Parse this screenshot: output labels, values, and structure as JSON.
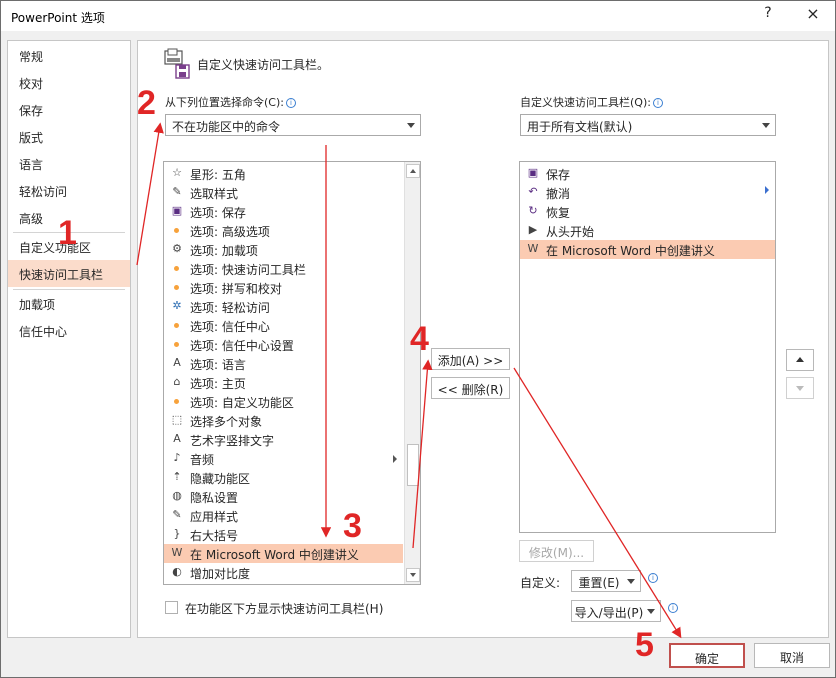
{
  "window": {
    "title": "PowerPoint 选项",
    "help": "?",
    "close": "×"
  },
  "nav": {
    "items": [
      "常规",
      "校对",
      "保存",
      "版式",
      "语言",
      "轻松访问",
      "高级",
      "自定义功能区",
      "快速访问工具栏",
      "加载项",
      "信任中心"
    ],
    "active_index": 8
  },
  "header": {
    "title": "自定义快速访问工具栏。"
  },
  "left": {
    "label": "从下列位置选择命令(C):",
    "dropdown_value": "不在功能区中的命令",
    "items": [
      {
        "label": "星形: 五角",
        "icon": "star-icon"
      },
      {
        "label": "选取样式",
        "icon": "eyedropper-icon"
      },
      {
        "label": "选项: 保存",
        "icon": "save-icon"
      },
      {
        "label": "选项: 高级选项",
        "icon": "bullet-icon"
      },
      {
        "label": "选项: 加载项",
        "icon": "addin-icon"
      },
      {
        "label": "选项: 快速访问工具栏",
        "icon": "bullet-icon"
      },
      {
        "label": "选项: 拼写和校对",
        "icon": "bullet-icon"
      },
      {
        "label": "选项: 轻松访问",
        "icon": "accessibility-icon"
      },
      {
        "label": "选项: 信任中心",
        "icon": "bullet-icon"
      },
      {
        "label": "选项: 信任中心设置",
        "icon": "bullet-icon"
      },
      {
        "label": "选项: 语言",
        "icon": "language-icon"
      },
      {
        "label": "选项: 主页",
        "icon": "home-icon"
      },
      {
        "label": "选项: 自定义功能区",
        "icon": "bullet-icon"
      },
      {
        "label": "选择多个对象",
        "icon": "select-objects-icon"
      },
      {
        "label": "艺术字竖排文字",
        "icon": "vertical-text-icon"
      },
      {
        "label": "音频",
        "icon": "audio-icon"
      },
      {
        "label": "隐藏功能区",
        "icon": "hide-ribbon-icon"
      },
      {
        "label": "隐私设置",
        "icon": "privacy-icon"
      },
      {
        "label": "应用样式",
        "icon": "eyedropper-icon"
      },
      {
        "label": "右大括号",
        "icon": "brace-icon"
      },
      {
        "label": "在 Microsoft Word 中创建讲义",
        "icon": "word-handout-icon"
      },
      {
        "label": "增加对比度",
        "icon": "contrast-icon"
      }
    ],
    "selected_index": 20,
    "checkbox_label": "在功能区下方显示快速访问工具栏(H)"
  },
  "middle": {
    "add": "添加(A) >>",
    "remove": "<< 删除(R)"
  },
  "right": {
    "label": "自定义快速访问工具栏(Q):",
    "dropdown_value": "用于所有文档(默认)",
    "items": [
      {
        "label": "保存",
        "icon": "save-icon"
      },
      {
        "label": "撤消",
        "icon": "undo-icon"
      },
      {
        "label": "恢复",
        "icon": "redo-icon"
      },
      {
        "label": "从头开始",
        "icon": "slideshow-icon"
      },
      {
        "label": "在 Microsoft Word 中创建讲义",
        "icon": "word-handout-icon"
      }
    ],
    "selected_index": 4,
    "modify": "修改(M)...",
    "customize_label": "自定义:",
    "reset": "重置(E)",
    "import_export": "导入/导出(P)"
  },
  "footer": {
    "ok": "确定",
    "cancel": "取消"
  },
  "annotations": {
    "numbers": [
      "1",
      "2",
      "3",
      "4",
      "5"
    ],
    "color": "#e02626"
  },
  "colors": {
    "active_nav": "#fbdccb",
    "selected_row": "#fbcbb2",
    "ok_border": "#c0504d"
  }
}
